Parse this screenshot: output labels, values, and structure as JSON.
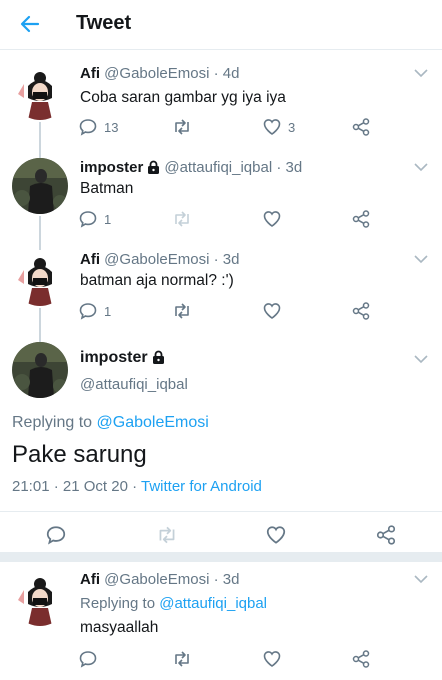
{
  "header": {
    "title": "Tweet",
    "back_icon": "arrow-left-icon",
    "accent": "#1da1f2"
  },
  "thread": [
    {
      "name": "Afi",
      "handle": "@GaboleEmosi",
      "time": "· 4d",
      "text": "Coba saran gambar yg iya iya",
      "replies": "13",
      "retweets": "",
      "likes": "3",
      "protected": false
    },
    {
      "name": "imposter",
      "handle": "@attaufiqi_iqbal",
      "time": "· 3d",
      "text": "Batman",
      "replies": "1",
      "retweets": "",
      "likes": "",
      "protected": true
    },
    {
      "name": "Afi",
      "handle": "@GaboleEmosi",
      "time": "· 3d",
      "text": "batman aja normal? :')",
      "replies": "1",
      "retweets": "",
      "likes": "",
      "protected": false
    }
  ],
  "main_tweet": {
    "name": "imposter",
    "handle": "@attaufiqi_iqbal",
    "replying_prefix": "Replying to",
    "replying_handle": "@GaboleEmosi",
    "text": "Pake sarung",
    "datetime": "21:01 · 21 Oct 20 ·",
    "source": "Twitter for Android",
    "protected": true
  },
  "reply": {
    "name": "Afi",
    "handle": "@GaboleEmosi",
    "time": "· 3d",
    "replying_prefix": "Replying to",
    "replying_handle": "@attaufiqi_iqbal",
    "text": "masyaallah"
  }
}
